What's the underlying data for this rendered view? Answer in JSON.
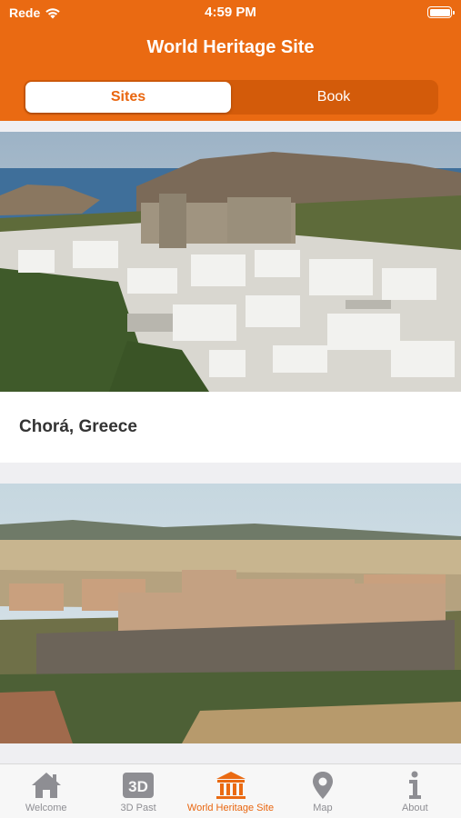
{
  "status": {
    "carrier": "Rede",
    "time": "4:59 PM"
  },
  "header": {
    "title": "World Heritage Site"
  },
  "segments": {
    "sites": "Sites",
    "book": "Book"
  },
  "sites": [
    {
      "caption": "Chorá, Greece"
    },
    {
      "caption": ""
    }
  ],
  "tabs": [
    {
      "label": "Welcome",
      "icon": "home-icon"
    },
    {
      "label": "3D Past",
      "icon": "3d-icon"
    },
    {
      "label": "World Heritage Site",
      "icon": "museum-icon"
    },
    {
      "label": "Map",
      "icon": "map-pin-icon"
    },
    {
      "label": "About",
      "icon": "info-icon"
    }
  ],
  "colors": {
    "accent": "#ea6a12",
    "inactive": "#8e8e93"
  }
}
